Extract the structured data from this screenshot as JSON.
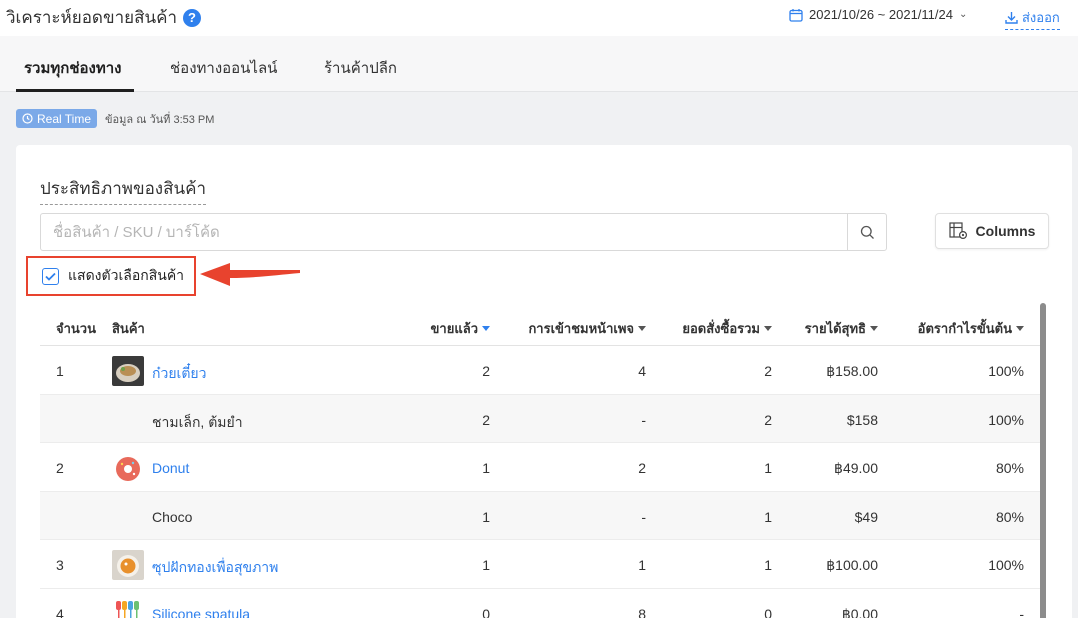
{
  "header": {
    "title": "วิเคราะห์ยอดขายสินค้า",
    "help_icon": "?",
    "date_range": "2021/10/26 ~ 2021/11/24",
    "export_label": "ส่งออก"
  },
  "tabs": [
    {
      "label": "รวมทุกช่องทาง",
      "active": true
    },
    {
      "label": "ช่องทางออนไลน์",
      "active": false
    },
    {
      "label": "ร้านค้าปลีก",
      "active": false
    }
  ],
  "realtime": {
    "badge": "Real Time",
    "text": "ข้อมูล ณ วันที่ 3:53 PM"
  },
  "card": {
    "title": "ประสิทธิภาพของสินค้า",
    "search_placeholder": "ชื่อสินค้า / SKU / บาร์โค้ด",
    "columns_label": "Columns",
    "show_variants_label": "แสดงตัวเลือกสินค้า",
    "show_variants_checked": true
  },
  "table": {
    "headers": {
      "no": "จำนวน",
      "product": "สินค้า",
      "sold": "ขายแล้ว",
      "views": "การเข้าชมหน้าเพจ",
      "orders": "ยอดสั่งซื้อรวม",
      "net": "รายได้สุทธิ",
      "margin": "อัตรากำไรขั้นต้น"
    },
    "rows": [
      {
        "no": "1",
        "product": "ก๋วยเตี๋ยว",
        "sold": "2",
        "views": "4",
        "orders": "2",
        "net": "฿158.00",
        "margin": "100%"
      },
      {
        "no": "",
        "product": "ชามเล็ก, ต้มยำ",
        "sold": "2",
        "views": "-",
        "orders": "2",
        "net": "$158",
        "margin": "100%"
      },
      {
        "no": "2",
        "product": "Donut",
        "sold": "1",
        "views": "2",
        "orders": "1",
        "net": "฿49.00",
        "margin": "80%"
      },
      {
        "no": "",
        "product": "Choco",
        "sold": "1",
        "views": "-",
        "orders": "1",
        "net": "$49",
        "margin": "80%"
      },
      {
        "no": "3",
        "product": "ซุปฝักทองเพื่อสุขภาพ",
        "sold": "1",
        "views": "1",
        "orders": "1",
        "net": "฿100.00",
        "margin": "100%"
      },
      {
        "no": "4",
        "product": "Silicone spatula",
        "sold": "0",
        "views": "8",
        "orders": "0",
        "net": "฿0.00",
        "margin": "-"
      }
    ]
  },
  "colors": {
    "accent": "#2f80ed",
    "highlight_border": "#e8432e",
    "badge": "#7ba9e8"
  }
}
